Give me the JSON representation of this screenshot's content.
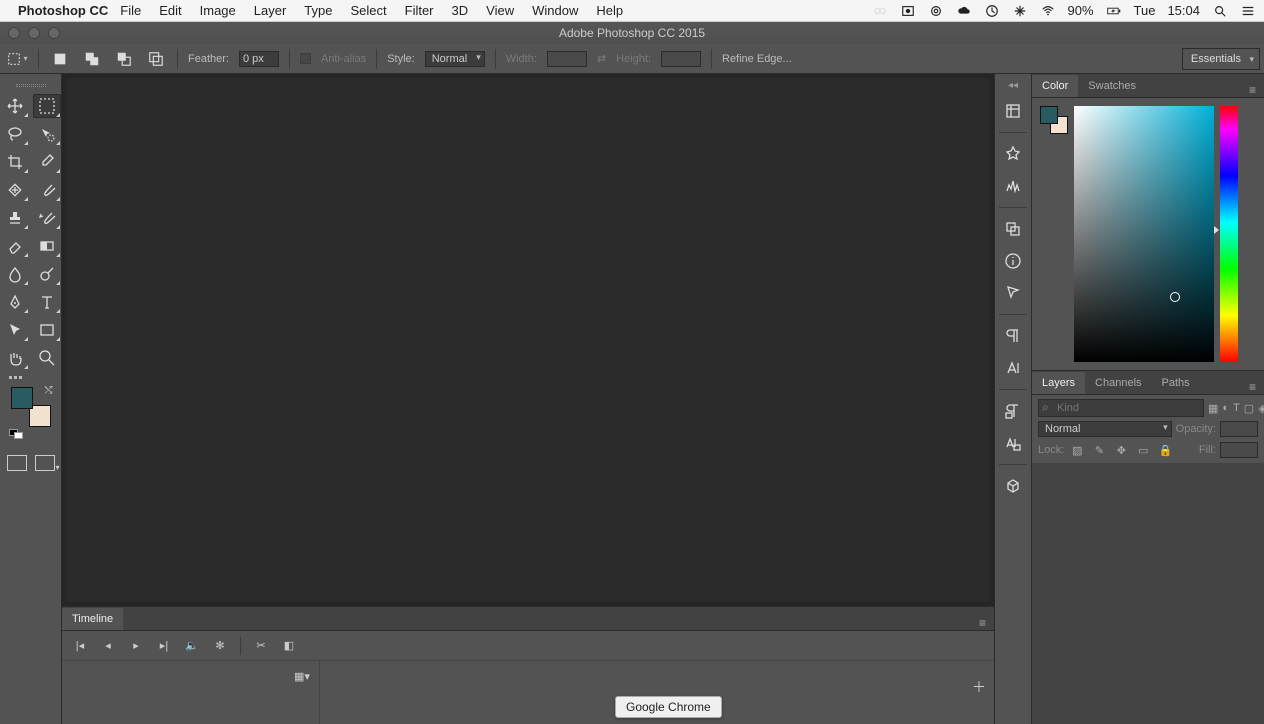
{
  "mac_menubar": {
    "app_name": "Photoshop CC",
    "menus": [
      "File",
      "Edit",
      "Image",
      "Layer",
      "Type",
      "Select",
      "Filter",
      "3D",
      "View",
      "Window",
      "Help"
    ],
    "battery_pct": "90%",
    "clock_day": "Tue",
    "clock_time": "15:04"
  },
  "window": {
    "title": "Adobe Photoshop CC 2015"
  },
  "options_bar": {
    "feather_label": "Feather:",
    "feather_value": "0 px",
    "antialias_label": "Anti-alias",
    "style_label": "Style:",
    "style_value": "Normal",
    "width_label": "Width:",
    "height_label": "Height:",
    "refine_label": "Refine Edge...",
    "workspace": "Essentials"
  },
  "panels": {
    "color_tab": "Color",
    "swatches_tab": "Swatches",
    "layers_tab": "Layers",
    "channels_tab": "Channels",
    "paths_tab": "Paths",
    "timeline_tab": "Timeline"
  },
  "layers": {
    "kind_placeholder": "Kind",
    "blend_mode": "Normal",
    "opacity_label": "Opacity:",
    "lock_label": "Lock:",
    "fill_label": "Fill:"
  },
  "colors": {
    "fg": "#2b5b62",
    "bg": "#f4e2d1"
  },
  "tooltip": "Google Chrome"
}
